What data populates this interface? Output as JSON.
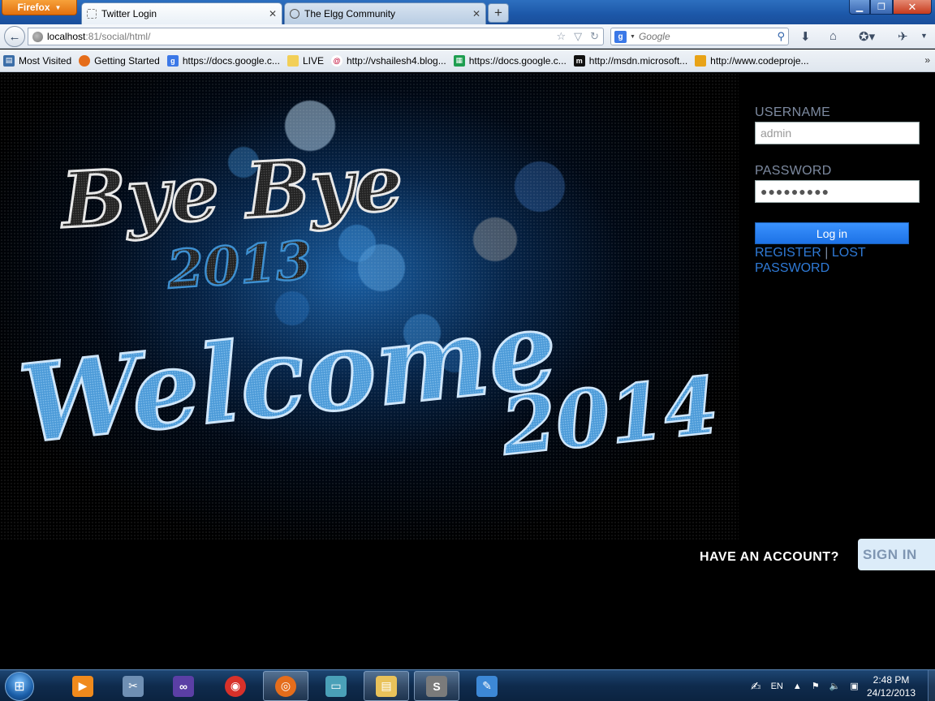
{
  "browser": {
    "menu_label": "Firefox",
    "tabs": [
      {
        "label": "Twitter Login",
        "active": true
      },
      {
        "label": "The Elgg Community",
        "active": false
      }
    ],
    "url": {
      "host": "localhost",
      "port_path": ":81/social/html/"
    },
    "search": {
      "engine_icon": "google-icon",
      "placeholder": "Google"
    },
    "bookmarks": [
      {
        "label": "Most Visited",
        "icon": "most-visited-icon",
        "color": "#3b6ea8"
      },
      {
        "label": "Getting Started",
        "icon": "firefox-icon",
        "color": "#e56d1b"
      },
      {
        "label": "https://docs.google.c...",
        "icon": "google-icon",
        "color": "#3b78e7"
      },
      {
        "label": "LIVE",
        "icon": "folder-icon",
        "color": "#f2cf57"
      },
      {
        "label": "http://vshailesh4.blog...",
        "icon": "debian-icon",
        "color": "#c4103d"
      },
      {
        "label": "https://docs.google.c...",
        "icon": "sheets-icon",
        "color": "#1e9e50"
      },
      {
        "label": "http://msdn.microsoft...",
        "icon": "msdn-icon",
        "color": "#111111"
      },
      {
        "label": "http://www.codeproje...",
        "icon": "codeproject-icon",
        "color": "#e8a317"
      }
    ]
  },
  "page": {
    "hero": {
      "line1": "Bye Bye",
      "line2": "2013",
      "line3": "Welcome",
      "line4": "2014"
    },
    "login": {
      "username_label": "USERNAME",
      "username_value": "admin",
      "password_label": "PASSWORD",
      "password_value": "●●●●●●●●●",
      "login_button": "Log in",
      "register_link": "REGISTER",
      "separator": "|",
      "lost_password_link": "LOST PASSWORD"
    },
    "account_prompt": "HAVE AN ACCOUNT?",
    "sign_in_button": "SIGN IN"
  },
  "taskbar": {
    "apps": [
      {
        "name": "media-player",
        "color": "#f08a1c"
      },
      {
        "name": "tools",
        "color": "#6f8fb3"
      },
      {
        "name": "visual-studio",
        "color": "#5b3fa5"
      },
      {
        "name": "chrome",
        "color": "#d8312a"
      },
      {
        "name": "firefox",
        "color": "#e56d1b"
      },
      {
        "name": "scanner",
        "color": "#4aa0b8"
      },
      {
        "name": "file-explorer",
        "color": "#e9c25a"
      },
      {
        "name": "sublime-text",
        "color": "#7b7b7b"
      },
      {
        "name": "paint",
        "color": "#3d88d6"
      }
    ],
    "language": "EN",
    "time": "2:48 PM",
    "date": "24/12/2013"
  },
  "colors": {
    "accent": "#1d72e6",
    "link": "#2f7ad6",
    "hero_blue": "#3d8fd0"
  }
}
